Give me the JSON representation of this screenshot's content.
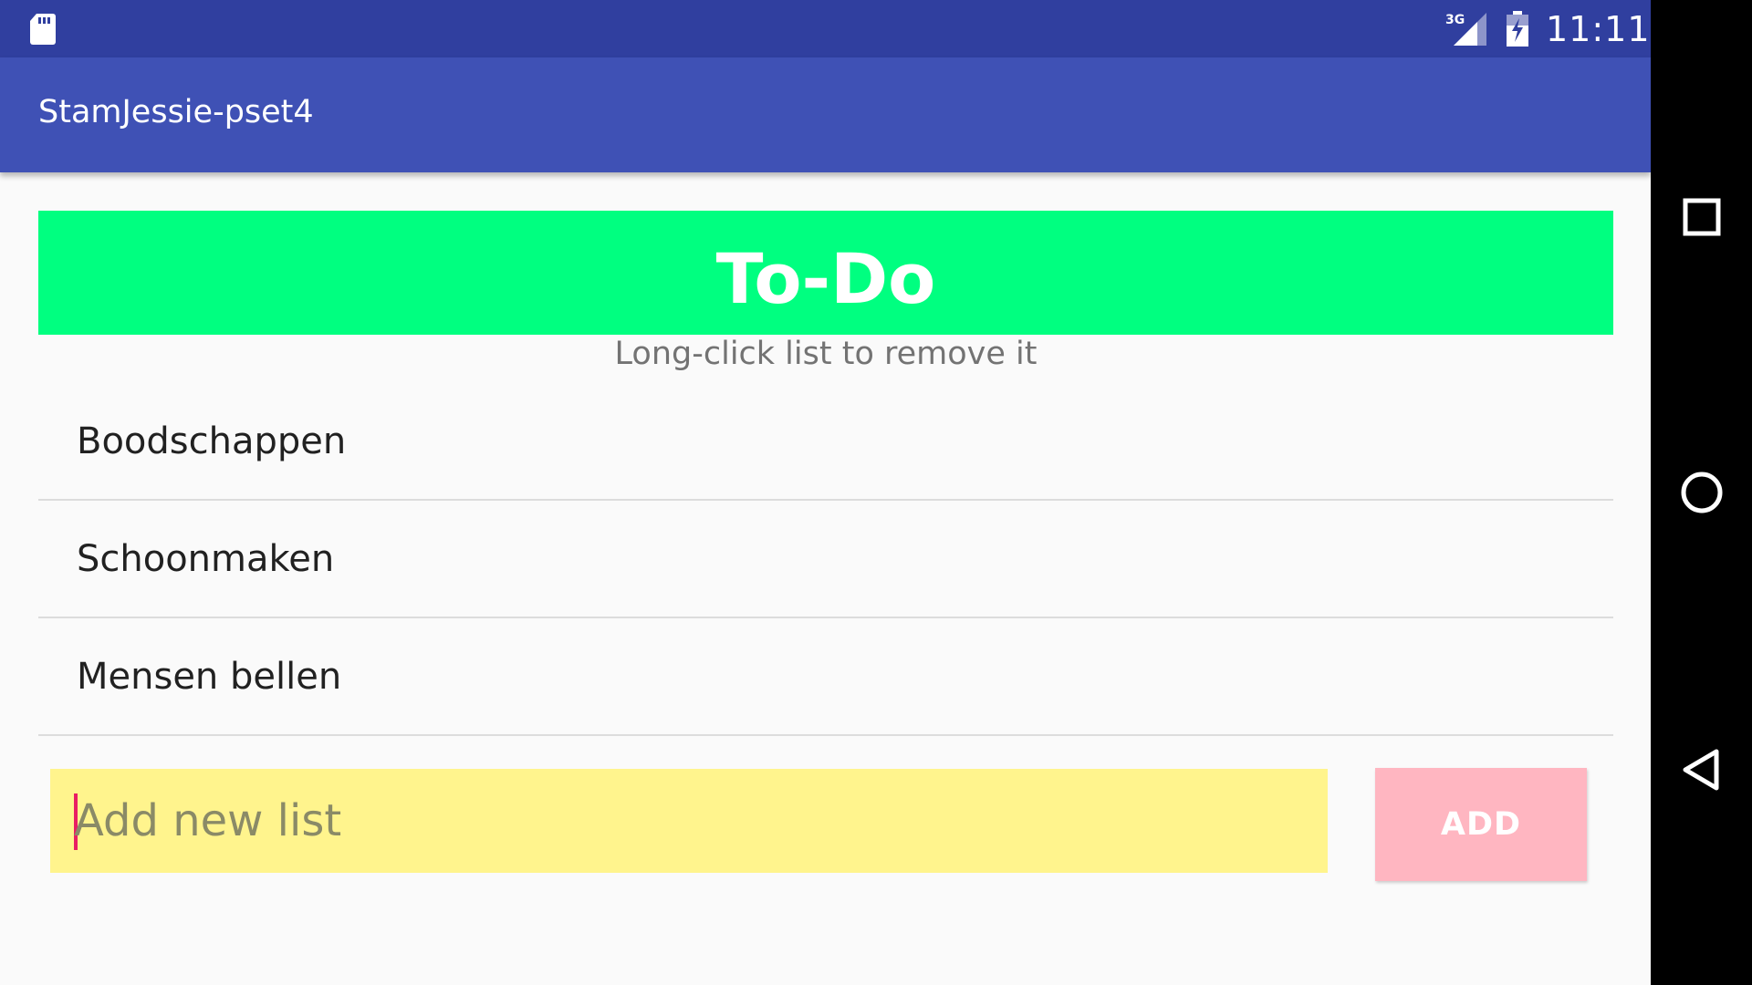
{
  "status_bar": {
    "time": "11:11",
    "network_label": "3G",
    "icons": [
      "sd-card-icon",
      "signal-3g-icon",
      "battery-charging-icon"
    ]
  },
  "app_bar": {
    "title": "StamJessie-pset4"
  },
  "header": {
    "title": "To-Do",
    "hint": "Long-click list to remove it"
  },
  "lists": [
    {
      "label": "Boodschappen"
    },
    {
      "label": "Schoonmaken"
    },
    {
      "label": "Mensen bellen"
    }
  ],
  "add_form": {
    "placeholder": "Add new list",
    "value": "",
    "button_label": "ADD"
  },
  "nav_bar": {
    "icons": [
      "recents-icon",
      "home-icon",
      "back-icon"
    ]
  },
  "colors": {
    "status_bar": "#303f9f",
    "app_bar": "#3f51b5",
    "banner": "#00ff80",
    "input_bg": "#fff48d",
    "button_bg": "#ffb6c1",
    "caret": "#e91e63"
  }
}
